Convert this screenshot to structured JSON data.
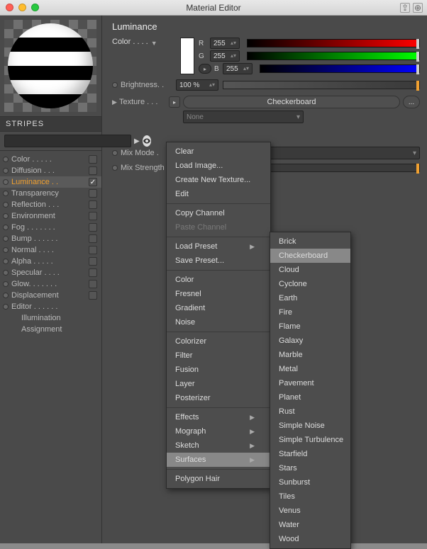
{
  "window": {
    "title": "Material Editor"
  },
  "material": {
    "name": "STRIPES"
  },
  "channels": [
    {
      "label": "Color . . . . .",
      "checked": false
    },
    {
      "label": "Diffusion . . .",
      "checked": false
    },
    {
      "label": "Luminance . .",
      "checked": true
    },
    {
      "label": "Transparency",
      "checked": false
    },
    {
      "label": "Reflection . . .",
      "checked": false
    },
    {
      "label": "Environment",
      "checked": false
    },
    {
      "label": "Fog . . . . . . .",
      "checked": false
    },
    {
      "label": "Bump . . . . . .",
      "checked": false
    },
    {
      "label": "Normal . . . .",
      "checked": false
    },
    {
      "label": "Alpha . . . . .",
      "checked": false
    },
    {
      "label": "Specular . . . .",
      "checked": false
    },
    {
      "label": "Glow. . . . . . .",
      "checked": false
    },
    {
      "label": "Displacement",
      "checked": false
    },
    {
      "label": "Editor . . . . . .",
      "sub": false,
      "nocheck": true
    },
    {
      "label": "Illumination",
      "sub": true
    },
    {
      "label": "Assignment",
      "sub": true
    }
  ],
  "panel": {
    "heading": "Luminance",
    "color_label": "Color . . . .",
    "rgb": {
      "r_label": "R",
      "g_label": "G",
      "b_label": "B",
      "r": "255",
      "g": "255",
      "b": "255"
    },
    "brightness_label": "Brightness. .",
    "brightness_value": "100 %",
    "texture_label": "Texture . . .",
    "texture_value": "Checkerboard",
    "texture_more": "...",
    "sampling_value": "None",
    "mixmode_label": "Mix Mode .",
    "mixstrength_label": "Mix Strength"
  },
  "menu1": {
    "items": [
      {
        "label": "Clear"
      },
      {
        "label": "Load Image..."
      },
      {
        "label": "Create New Texture..."
      },
      {
        "label": "Edit"
      }
    ],
    "items2": [
      {
        "label": "Copy Channel"
      },
      {
        "label": "Paste Channel",
        "disabled": true
      }
    ],
    "items3": [
      {
        "label": "Load Preset",
        "sub": true
      },
      {
        "label": "Save Preset..."
      }
    ],
    "items4": [
      {
        "label": "Color"
      },
      {
        "label": "Fresnel"
      },
      {
        "label": "Gradient"
      },
      {
        "label": "Noise"
      }
    ],
    "items5": [
      {
        "label": "Colorizer"
      },
      {
        "label": "Filter"
      },
      {
        "label": "Fusion"
      },
      {
        "label": "Layer"
      },
      {
        "label": "Posterizer"
      }
    ],
    "items6": [
      {
        "label": "Effects",
        "sub": true
      },
      {
        "label": "Mograph",
        "sub": true
      },
      {
        "label": "Sketch",
        "sub": true
      },
      {
        "label": "Surfaces",
        "sub": true,
        "hl": true
      }
    ],
    "items7": [
      {
        "label": "Polygon Hair"
      }
    ]
  },
  "menu2": {
    "items": [
      "Brick",
      "Checkerboard",
      "Cloud",
      "Cyclone",
      "Earth",
      "Fire",
      "Flame",
      "Galaxy",
      "Marble",
      "Metal",
      "Pavement",
      "Planet",
      "Rust",
      "Simple Noise",
      "Simple Turbulence",
      "Starfield",
      "Stars",
      "Sunburst",
      "Tiles",
      "Venus",
      "Water",
      "Wood"
    ],
    "highlight_index": 1
  }
}
